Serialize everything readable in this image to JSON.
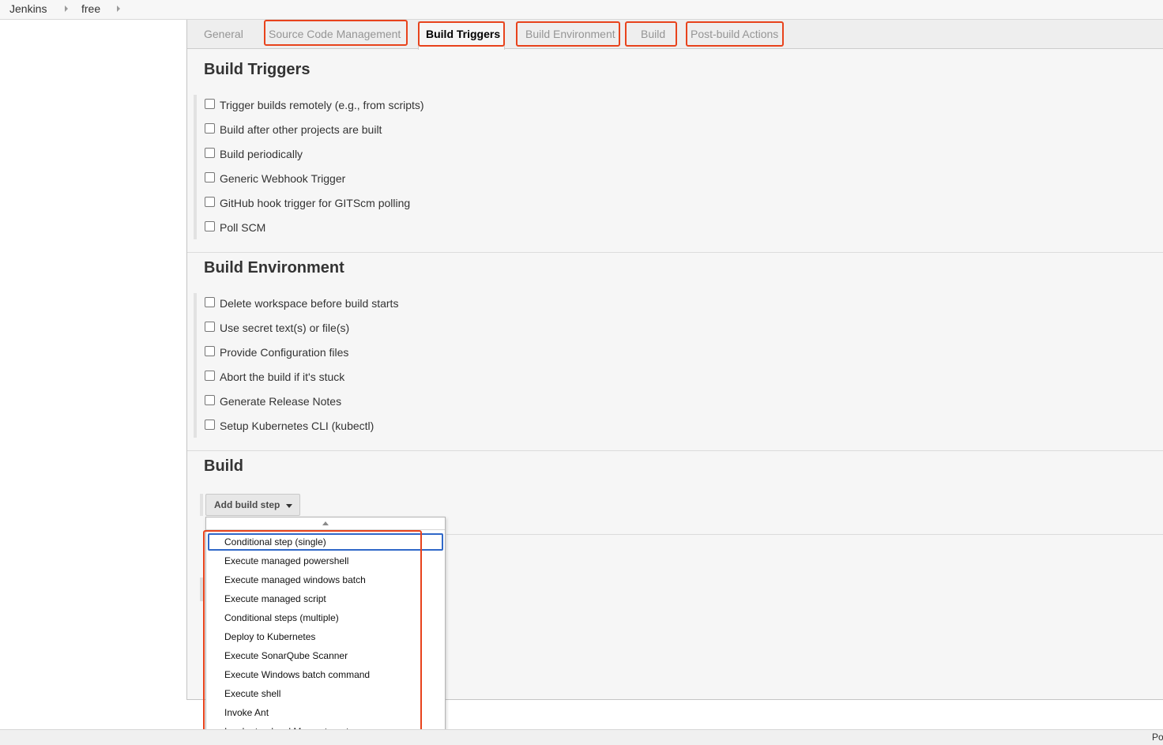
{
  "breadcrumb": {
    "items": [
      {
        "label": "Jenkins"
      },
      {
        "label": "free"
      }
    ]
  },
  "tabs": [
    {
      "label": "General",
      "active": false,
      "highlighted": false
    },
    {
      "label": "Source Code Management",
      "active": false,
      "highlighted": true
    },
    {
      "label": "Build Triggers",
      "active": true,
      "highlighted": true
    },
    {
      "label": "Build Environment",
      "active": false,
      "highlighted": true
    },
    {
      "label": "Build",
      "active": false,
      "highlighted": true
    },
    {
      "label": "Post-build Actions",
      "active": false,
      "highlighted": true
    }
  ],
  "build_triggers": {
    "title": "Build Triggers",
    "options": [
      {
        "label": "Trigger builds remotely (e.g., from scripts)",
        "checked": false
      },
      {
        "label": "Build after other projects are built",
        "checked": false
      },
      {
        "label": "Build periodically",
        "checked": false
      },
      {
        "label": "Generic Webhook Trigger",
        "checked": false
      },
      {
        "label": "GitHub hook trigger for GITScm polling",
        "checked": false
      },
      {
        "label": "Poll SCM",
        "checked": false
      }
    ]
  },
  "build_environment": {
    "title": "Build Environment",
    "options": [
      {
        "label": "Delete workspace before build starts",
        "checked": false
      },
      {
        "label": "Use secret text(s) or file(s)",
        "checked": false
      },
      {
        "label": "Provide Configuration files",
        "checked": false
      },
      {
        "label": "Abort the build if it's stuck",
        "checked": false
      },
      {
        "label": "Generate Release Notes",
        "checked": false
      },
      {
        "label": "Setup Kubernetes CLI (kubectl)",
        "checked": false
      }
    ]
  },
  "build": {
    "title": "Build",
    "add_step_label": "Add build step",
    "menu_items": [
      {
        "label": "Conditional step (single)",
        "focused": true
      },
      {
        "label": "Execute managed powershell",
        "focused": false
      },
      {
        "label": "Execute managed windows batch",
        "focused": false
      },
      {
        "label": "Execute managed script",
        "focused": false
      },
      {
        "label": "Conditional steps (multiple)",
        "focused": false
      },
      {
        "label": "Deploy to Kubernetes",
        "focused": false
      },
      {
        "label": "Execute SonarQube Scanner",
        "focused": false
      },
      {
        "label": "Execute Windows batch command",
        "focused": false
      },
      {
        "label": "Execute shell",
        "focused": false
      },
      {
        "label": "Invoke Ant",
        "focused": false
      },
      {
        "label": "Invoke top-level Maven targets",
        "focused": false
      }
    ]
  },
  "footer": {
    "edge_text": "Po"
  },
  "colors": {
    "highlight": "#e8431c",
    "focus": "#3068c8"
  }
}
